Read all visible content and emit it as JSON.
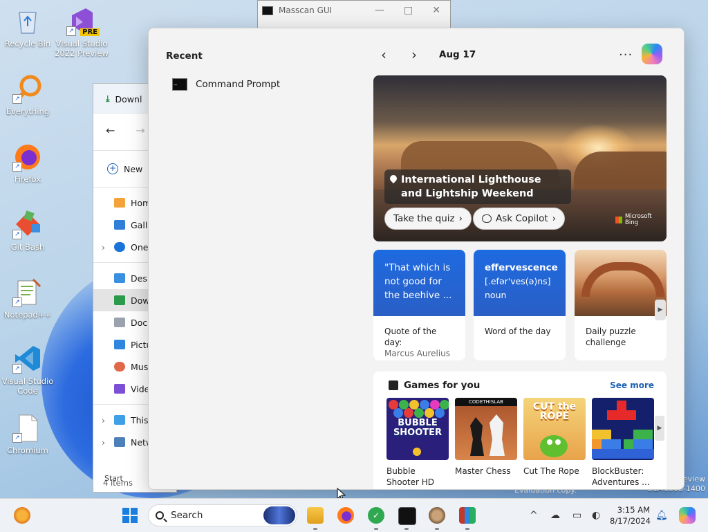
{
  "desktop": {
    "icons": [
      {
        "label": "Recycle Bin",
        "icon": "recycle-bin-icon"
      },
      {
        "label": "Visual Studio 2022 Preview",
        "badge": "PRE",
        "icon": "visual-studio-icon"
      },
      {
        "label": "Everything",
        "icon": "everything-icon"
      },
      {
        "label": "Firefox",
        "icon": "firefox-icon"
      },
      {
        "label": "Git Bash",
        "icon": "git-bash-icon"
      },
      {
        "label": "Notepad++",
        "icon": "notepad-plus-plus-icon"
      },
      {
        "label": "Visual Studio Code",
        "icon": "vscode-icon"
      },
      {
        "label": "Chromium",
        "icon": "file-icon"
      }
    ],
    "watermark_line1": "eview",
    "watermark_line2": "d.240508-1400",
    "evaluation": "Evaluation copy."
  },
  "masscan": {
    "title": "Masscan GUI",
    "minimize": "—",
    "maximize": "□",
    "close": "✕"
  },
  "explorer": {
    "tab": "Downl",
    "back": "←",
    "forward": "→",
    "new_label": "New",
    "nav": [
      {
        "label": "Hom"
      },
      {
        "label": "Galle"
      },
      {
        "label": "OneI"
      },
      {
        "label": "Desk"
      },
      {
        "label": "Dow"
      },
      {
        "label": "Docu"
      },
      {
        "label": "Pictu"
      },
      {
        "label": "Musi"
      },
      {
        "label": "Vide"
      },
      {
        "label": "This"
      },
      {
        "label": "Netw"
      }
    ],
    "item_count": "4 items"
  },
  "start": {
    "label": "Start",
    "recent_title": "Recent",
    "recent_items": [
      {
        "label": "Command Prompt"
      }
    ],
    "nav": {
      "prev": "‹",
      "next": "›",
      "date": "Aug 17",
      "more": "···"
    },
    "hero": {
      "title": "International Lighthouse and Lightship Weekend",
      "quiz_label": "Take the quiz",
      "copilot_label": "Ask Copilot",
      "brand_line1": "Microsoft",
      "brand_line2": "Bing"
    },
    "cards": [
      {
        "top": "\"That which is not good for the beehive ...",
        "title": "Quote of the day:",
        "sub": "Marcus Aurelius"
      },
      {
        "word": "effervescence",
        "phonetic": "[.efər'ves(ə)ns]",
        "pos": "noun",
        "title": "Word of the day"
      },
      {
        "title": "Daily puzzle challenge"
      }
    ],
    "games": {
      "title": "Games for you",
      "see_more": "See more",
      "items": [
        {
          "name": "Bubble Shooter HD",
          "thumb_text": "BUBBLE SHOOTER"
        },
        {
          "name": "Master Chess",
          "thumb_text": "CODETHISLAB"
        },
        {
          "name": "Cut The Rope",
          "thumb_text": "CUT the ROPE"
        },
        {
          "name": "BlockBuster: Adventures ..."
        }
      ]
    }
  },
  "taskbar": {
    "search_placeholder": "Search",
    "time": "3:15 AM",
    "date": "8/17/2024",
    "tray_chevron": "^"
  }
}
